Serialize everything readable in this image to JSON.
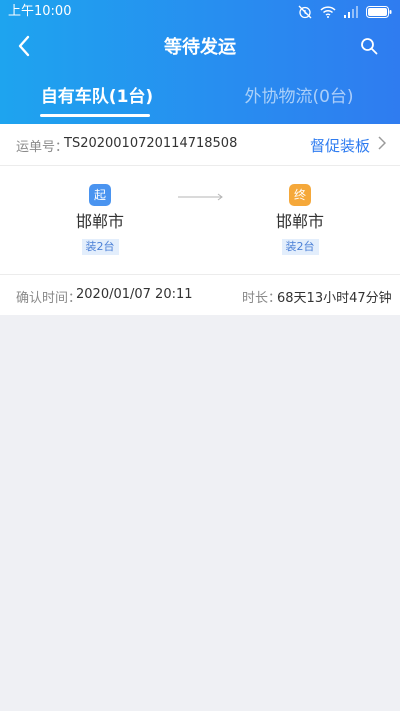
{
  "status_bar": {
    "time": "上午10:00",
    "icons": [
      "alarm-off-icon",
      "wifi-icon",
      "signal-icon",
      "battery-icon"
    ]
  },
  "header": {
    "title": "等待发运",
    "back_icon": "back-arrow-icon",
    "search_icon": "search-icon",
    "gradient_start": "#1ea4ef",
    "gradient_end": "#2f7cf0"
  },
  "tabs": [
    {
      "label": "自有车队(1台)",
      "active": true
    },
    {
      "label": "外协物流(0台)",
      "active": false
    }
  ],
  "shipment": {
    "waybill_label": "运单号：",
    "waybill_number": "TS2020010720114718508",
    "urge_label": "督促装板",
    "origin": {
      "badge": "起",
      "city": "邯郸市",
      "load": "装2台",
      "badge_color": "#4a94f0"
    },
    "destination": {
      "badge": "终",
      "city": "邯郸市",
      "load": "装2台",
      "badge_color": "#f5a83a"
    },
    "confirm_label": "确认时间：",
    "confirm_time": "2020/01/07 20:11",
    "duration_label": "时长：",
    "duration": "68天13小时47分钟"
  },
  "colors": {
    "accent": "#2f7cf0",
    "page_bg": "#eff0f4"
  }
}
